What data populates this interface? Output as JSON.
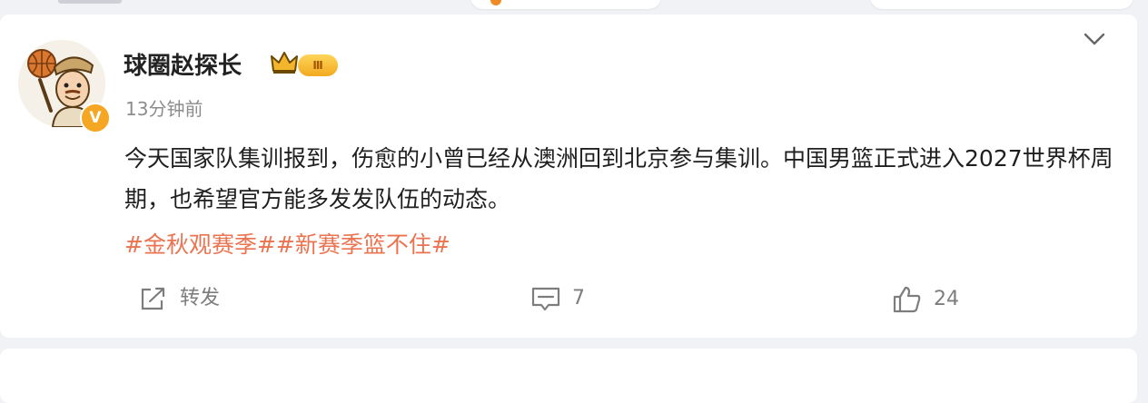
{
  "post": {
    "username": "球圈赵探长",
    "level_badge": "Ⅲ",
    "verified_mark": "V",
    "time": "13分钟前",
    "content": "今天国家队集训报到，伤愈的小曾已经从澳洲回到北京参与集训。中国男篮正式进入2027世界杯周期，也希望官方能多发发队伍的动态。",
    "tags": "#金秋观赛季##新赛季篮不住#",
    "actions": {
      "repost_label": "转发",
      "comment_count": "7",
      "like_count": "24"
    },
    "colors": {
      "tag": "#eb7350",
      "badge_gold": "#f5a623",
      "muted": "#8c8c8c"
    },
    "icons": [
      "crown-icon",
      "chevron-down-icon",
      "repost-icon",
      "comment-icon",
      "like-icon"
    ]
  }
}
